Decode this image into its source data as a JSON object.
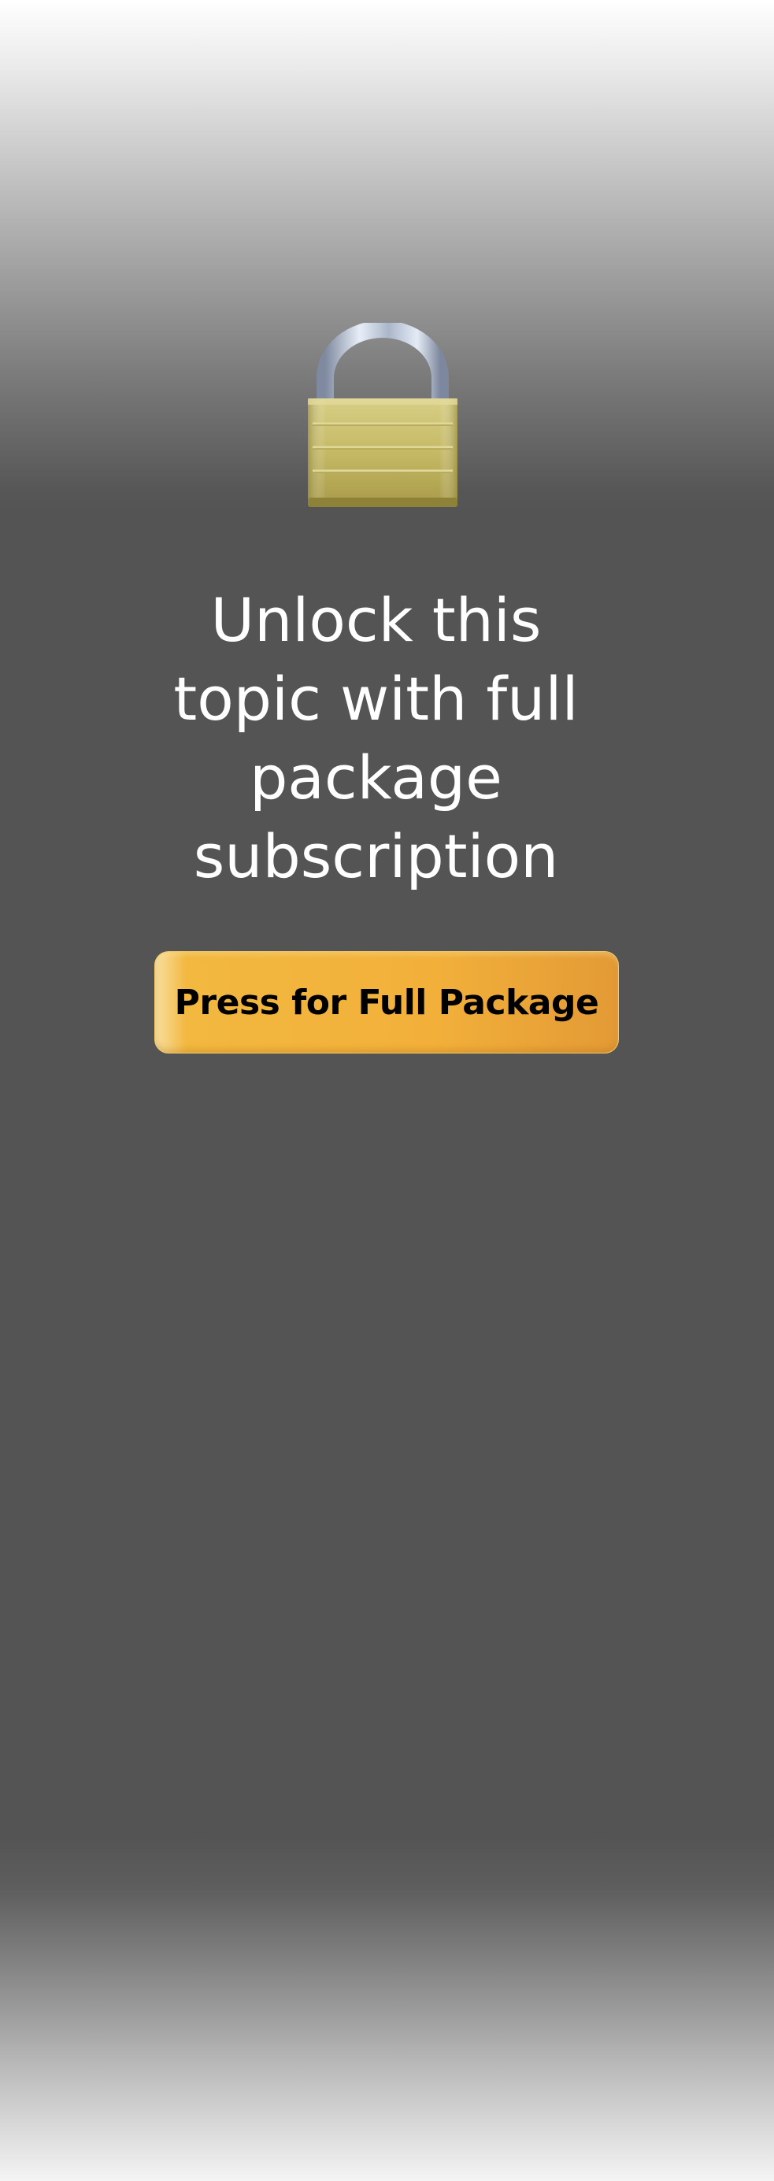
{
  "lock": {
    "icon": "padlock-icon",
    "shackle_color": "#b8c4d8",
    "body_color": "#c9bd6a"
  },
  "message": {
    "line1": "Unlock this",
    "line2": "topic with full",
    "line3": "package",
    "line4": "subscription"
  },
  "cta": {
    "label": "Press for Full Package",
    "color": "#f2b03a"
  },
  "theme": {
    "background": "#545454",
    "text_color": "#ffffff"
  }
}
